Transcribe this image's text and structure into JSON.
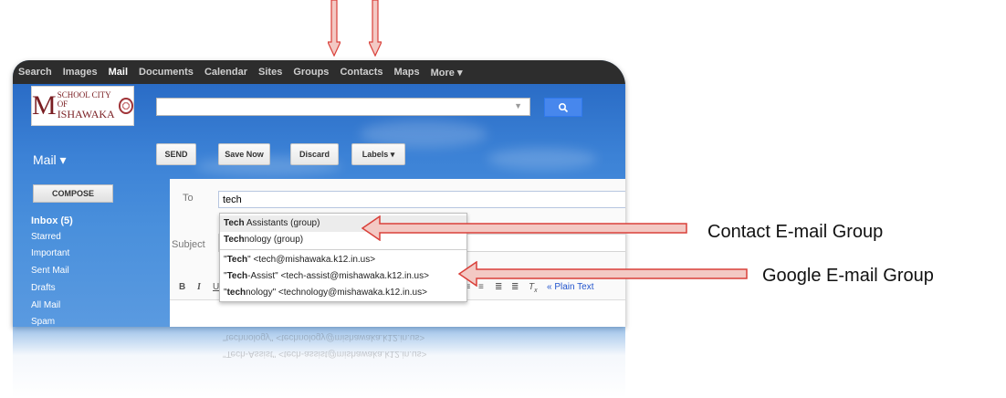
{
  "navbar": {
    "items": [
      "Search",
      "Images",
      "Mail",
      "Documents",
      "Calendar",
      "Sites",
      "Groups",
      "Contacts",
      "Maps",
      "More ▾"
    ],
    "active": "Mail"
  },
  "logo": {
    "big_letter": "M",
    "line1": "SCHOOL CITY OF",
    "line2": "ISHAWAKA"
  },
  "search": {
    "value": ""
  },
  "mail_menu": "Mail ▾",
  "toolbar": {
    "send": "SEND",
    "save_now": "Save Now",
    "discard": "Discard",
    "labels": "Labels ▾"
  },
  "sidebar": {
    "compose": "COMPOSE",
    "items": [
      "Inbox (5)",
      "Starred",
      "Important",
      "Sent Mail",
      "Drafts",
      "All Mail",
      "Spam"
    ]
  },
  "compose": {
    "to_label": "To",
    "to_value": "tech",
    "subject_label": "Subject",
    "plain_text_link": "« Plain Text"
  },
  "autocomplete": [
    {
      "bold": "Tech",
      "rest": " Assistants (group)"
    },
    {
      "bold": "Tech",
      "rest": "nology (group)"
    },
    {
      "pre": "\"",
      "bold": "Tech",
      "rest": "\" <tech@mishawaka.k12.in.us>"
    },
    {
      "pre": "\"",
      "bold": "Tech",
      "rest": "-Assist\" <tech-assist@mishawaka.k12.in.us>"
    },
    {
      "pre": "\"",
      "bold": "tech",
      "rest": "nology\" <technology@mishawaka.k12.in.us>"
    }
  ],
  "annotations": {
    "contact_group": "Contact E-mail Group",
    "google_group": "Google E-mail Group"
  },
  "colors": {
    "arrow_red": "#d9403a",
    "arrow_fill": "#f3c9c4",
    "nav_bg": "#2d2d2d",
    "sky": "#3c82d6"
  }
}
